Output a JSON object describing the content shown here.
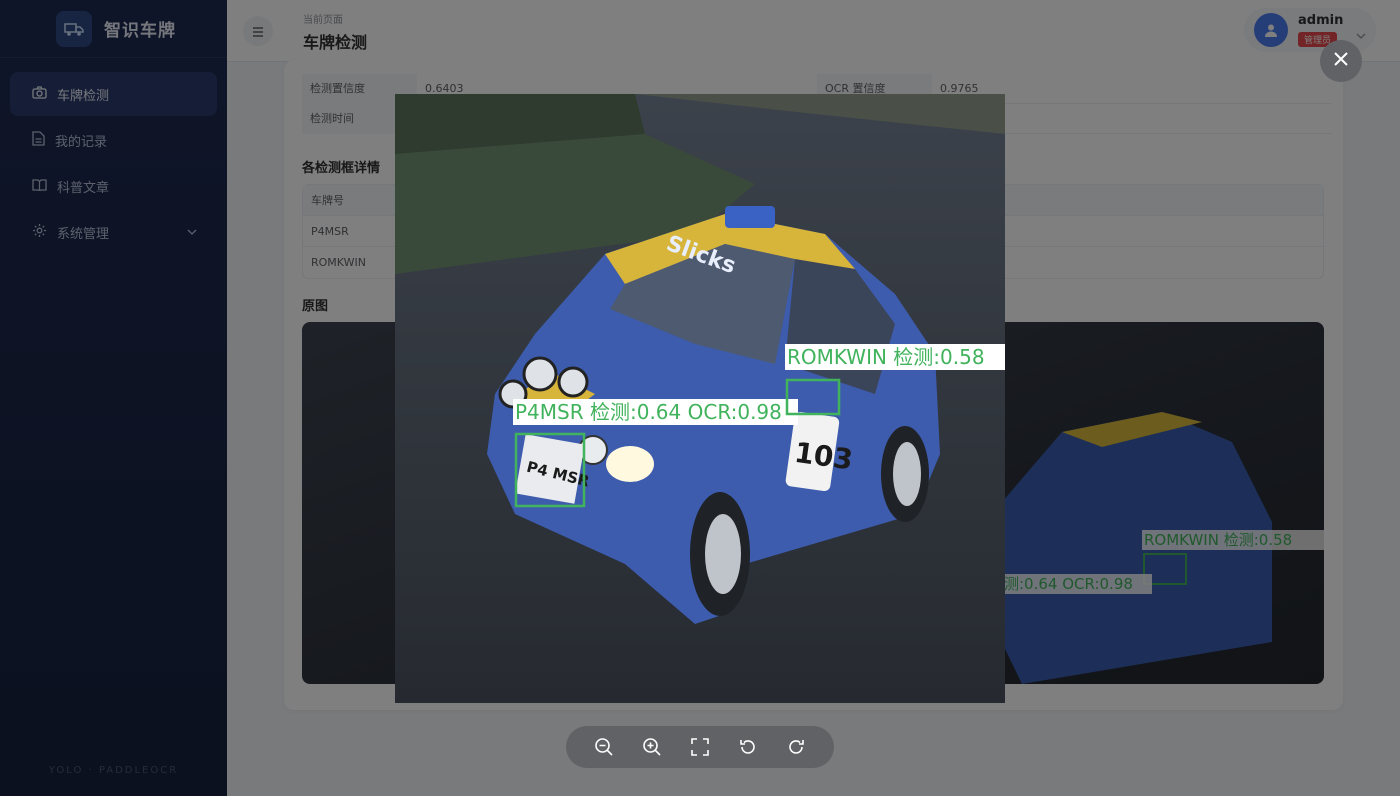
{
  "brand": {
    "title": "智识车牌"
  },
  "sidebar": {
    "items": [
      {
        "label": "车牌检测",
        "icon": "camera-icon",
        "active": true
      },
      {
        "label": "我的记录",
        "icon": "document-icon",
        "active": false
      },
      {
        "label": "科普文章",
        "icon": "book-icon",
        "active": false
      },
      {
        "label": "系统管理",
        "icon": "gear-icon",
        "active": false,
        "has_submenu": true
      }
    ],
    "footer": "YOLO · PADDLEOCR"
  },
  "header": {
    "breadcrumb_small": "当前页面",
    "page_title": "车牌检测",
    "user_name": "admin",
    "user_role": "管理员"
  },
  "result": {
    "det_conf_label": "检测置信度",
    "det_conf_value": "0.6403",
    "ocr_conf_label": "OCR 置信度",
    "ocr_conf_value": "0.9765",
    "time_label": "检测时间"
  },
  "boxes_section": {
    "title": "各检测框详情",
    "column_plate": "车牌号",
    "rows": [
      "P4MSR",
      "ROMKWIN"
    ]
  },
  "original_section": {
    "title": "原图"
  },
  "preview": {
    "det1_label": "P4MSR 检测:0.64 OCR:0.98",
    "det2_label": "ROMKWIN 检测:0.58",
    "plate_text": "P4 MSR",
    "sponsor_text": "Slicks",
    "car_number": "103",
    "orig_det1_label": "测:0.64 OCR:0.98",
    "orig_det2_label": "ROMKWIN 检测:0.58",
    "box_color": "#41b35d"
  },
  "toolbar_icons": [
    "zoom-out-icon",
    "zoom-in-icon",
    "fullscreen-icon",
    "rotate-left-icon",
    "rotate-right-icon"
  ]
}
